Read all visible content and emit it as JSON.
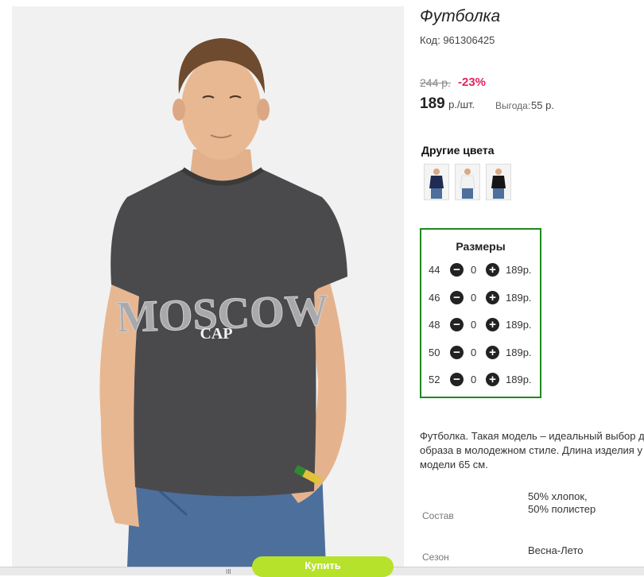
{
  "product": {
    "title": "Футболка",
    "code": "Код: 961306425",
    "old_price": "244 р.",
    "discount": "-23%",
    "price": "189",
    "price_unit": "р./шт.",
    "benefit_label": "Выгода:",
    "benefit_value": "55 р.",
    "print_text_main": "MOSCOW",
    "print_text_sub": "CAP"
  },
  "colors": {
    "title": "Другие цвета",
    "items": [
      {
        "name": "navy-tshirt",
        "color": "#1f2b52"
      },
      {
        "name": "white-tshirt",
        "color": "#f2f2f2"
      },
      {
        "name": "black-tshirt",
        "color": "#151515"
      }
    ]
  },
  "sizes": {
    "title": "Размеры",
    "minus_icon": "−",
    "plus_icon": "+",
    "items": [
      {
        "size": "44",
        "qty": "0",
        "price": "189р."
      },
      {
        "size": "46",
        "qty": "0",
        "price": "189р."
      },
      {
        "size": "48",
        "qty": "0",
        "price": "189р."
      },
      {
        "size": "50",
        "qty": "0",
        "price": "189р."
      },
      {
        "size": "52",
        "qty": "0",
        "price": "189р."
      }
    ]
  },
  "description": "Футболка. Такая модель – идеальный выбор для образа в молодежном стиле. Длина изделия у модели 65 см.",
  "specs": [
    {
      "label": "Состав",
      "value": "50% хлопок, 50% полистер"
    },
    {
      "label": "Сезон",
      "value": "Весна-Лето"
    }
  ],
  "buy_button": "Купить",
  "scroll_grip": "III",
  "accent_colors": {
    "discount": "#e0245e",
    "sizes_border": "#1e8a1e",
    "buy_button": "#b7e22b"
  }
}
